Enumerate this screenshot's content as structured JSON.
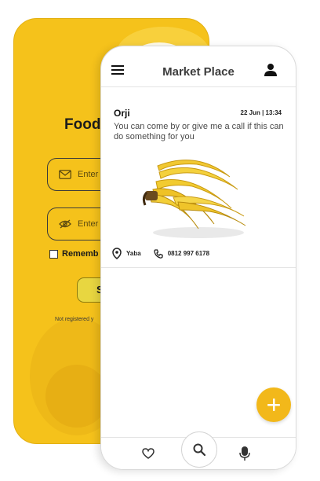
{
  "login": {
    "brand": "FoodI",
    "email_placeholder": "Enter",
    "password_placeholder": "Enter",
    "remember_label": "Rememb",
    "signin_label": "Si",
    "not_registered_text": "Not registered y"
  },
  "market": {
    "title": "Market Place",
    "post": {
      "author": "Orji",
      "timestamp": "22 Jun | 13:34",
      "message": "You can come by or give me a call if this can do something for you",
      "location": "Yaba",
      "phone": "0812 997 6178"
    }
  },
  "colors": {
    "accent": "#f2b81a",
    "login_bg": "#f5c21b"
  },
  "icons": [
    "menu-icon",
    "user-icon",
    "location-pin-icon",
    "phone-icon",
    "plus-icon",
    "heart-icon",
    "search-icon",
    "microphone-icon",
    "mail-icon",
    "eye-off-icon"
  ]
}
